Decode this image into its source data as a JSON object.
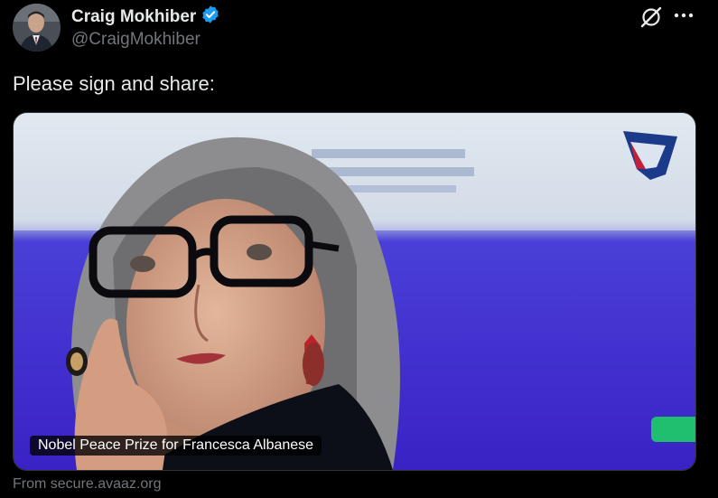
{
  "author": {
    "display_name": "Craig Mokhiber",
    "handle": "@CraigMokhiber",
    "verified": true
  },
  "tweet": {
    "text": "Please sign and share:"
  },
  "card": {
    "caption": "Nobel Peace Prize for Francesca Albanese",
    "source": "From secure.avaaz.org"
  },
  "icons": {
    "verified": "verified-badge-icon",
    "grok": "grok-icon",
    "more": "more-options-icon"
  },
  "colors": {
    "background": "#000000",
    "text_primary": "#e7e9ea",
    "text_secondary": "#71767b",
    "verified_blue": "#1d9bf0",
    "image_backdrop": "#4a2fd6"
  }
}
